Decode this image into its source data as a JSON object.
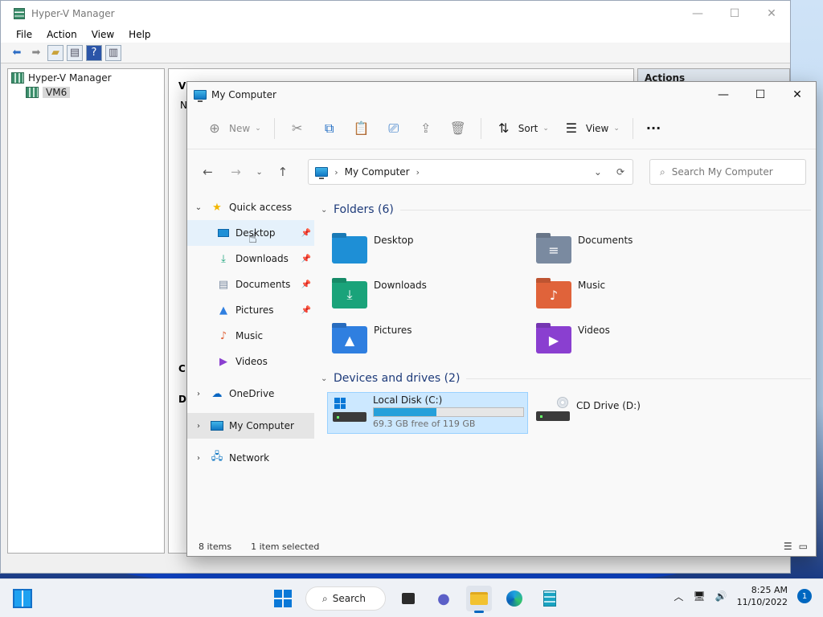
{
  "hyperv": {
    "title": "Hyper-V Manager",
    "menu": [
      "File",
      "Action",
      "View",
      "Help"
    ],
    "tree": [
      {
        "label": "Hyper-V Manager"
      },
      {
        "label": "VM6"
      }
    ],
    "actions_title": "Actions",
    "mid_fragments": [
      "Vi",
      "N",
      "C",
      "D"
    ]
  },
  "explorer": {
    "title": "My Computer",
    "toolbar": {
      "new_label": "New",
      "sort_label": "Sort",
      "view_label": "View",
      "more_label": "···"
    },
    "address": {
      "location": "My Computer",
      "search_placeholder": "Search My Computer"
    },
    "nav": {
      "quick_access": "Quick access",
      "items": [
        {
          "label": "Desktop",
          "icon": "desktop-icon"
        },
        {
          "label": "Downloads",
          "icon": "download-icon"
        },
        {
          "label": "Documents",
          "icon": "document-icon"
        },
        {
          "label": "Pictures",
          "icon": "picture-icon"
        },
        {
          "label": "Music",
          "icon": "music-icon"
        },
        {
          "label": "Videos",
          "icon": "video-icon"
        }
      ],
      "onedrive": "OneDrive",
      "my_computer": "My Computer",
      "network": "Network"
    },
    "folders_header": "Folders (6)",
    "folders": [
      {
        "name": "Desktop",
        "color": "#1e8fd6"
      },
      {
        "name": "Documents",
        "color": "#7a8aa0"
      },
      {
        "name": "Downloads",
        "color": "#1aa37a"
      },
      {
        "name": "Music",
        "color": "#e0633a"
      },
      {
        "name": "Pictures",
        "color": "#2f7fe0"
      },
      {
        "name": "Videos",
        "color": "#8a3fd0"
      }
    ],
    "drives_header": "Devices and drives (2)",
    "drives": [
      {
        "name": "Local Disk (C:)",
        "free": "69.3 GB free of 119 GB",
        "used_fraction": 0.418
      },
      {
        "name": "CD Drive (D:)"
      }
    ],
    "status": {
      "items": "8 items",
      "selected": "1 item selected"
    }
  },
  "taskbar": {
    "search_label": "Search",
    "time": "8:25 AM",
    "date": "11/10/2022",
    "notification_count": "1"
  }
}
